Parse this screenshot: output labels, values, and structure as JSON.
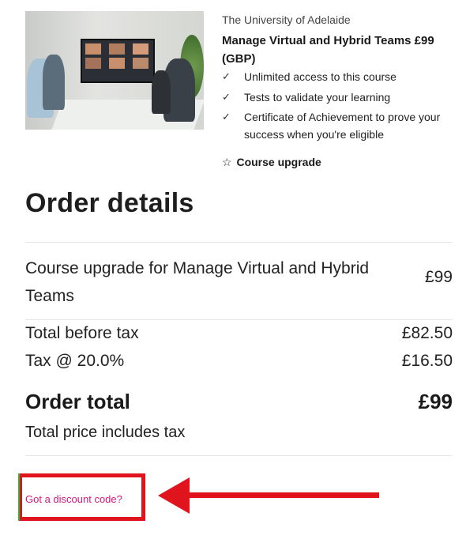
{
  "product": {
    "provider": "The University of Adelaide",
    "title": "Manage Virtual and Hybrid Teams £99 (GBP)",
    "features": [
      "Unlimited access to this course",
      "Tests to validate your learning",
      "Certificate of Achievement to prove your success when you're eligible"
    ],
    "upgrade_label": "Course upgrade",
    "upgrade_icon": "star-outline-icon",
    "tick_icon": "check-icon"
  },
  "order": {
    "heading": "Order details",
    "item_label": "Course upgrade for Manage Virtual and Hybrid Teams",
    "item_price": "£99",
    "subtotal_label": "Total before tax",
    "subtotal_value": "£82.50",
    "tax_label": "Tax @ 20.0%",
    "tax_value": "£16.50",
    "total_label": "Order total",
    "total_value": "£99",
    "tax_note": "Total price includes tax"
  },
  "discount": {
    "link_label": "Got a discount code?",
    "link_color": "#d4187e",
    "highlight_color": "#e0141c"
  }
}
